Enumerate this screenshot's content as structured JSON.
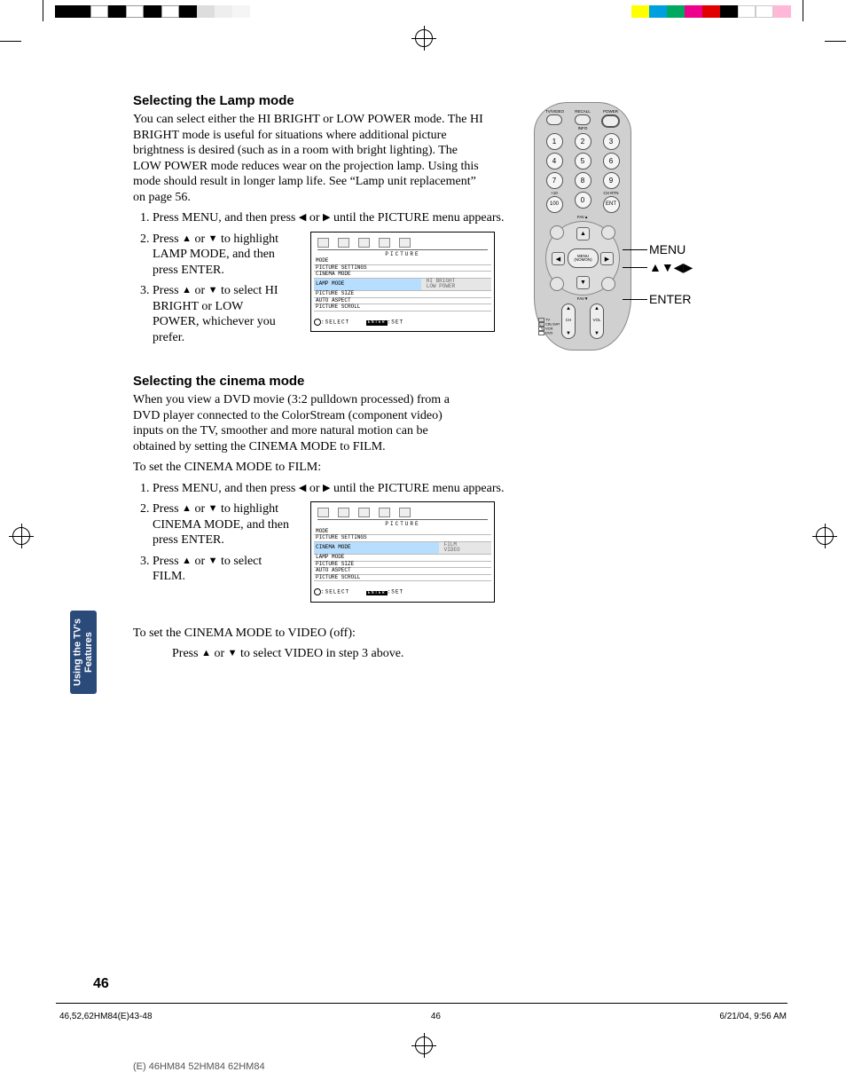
{
  "section1": {
    "heading": "Selecting the Lamp mode",
    "para": "You can select either the HI BRIGHT or LOW POWER mode. The HI BRIGHT mode is useful for situations where additional picture brightness is desired (such as in a room with bright lighting).  The LOW POWER mode reduces wear on the projection lamp. Using this mode should result in longer lamp life.  See “Lamp unit replacement” on page 56.",
    "step1a": "Press MENU, and then press ",
    "step1b": " or ",
    "step1c": " until the PICTURE menu appears.",
    "step2a": "Press ",
    "step2b": " or ",
    "step2c": " to highlight LAMP MODE, and then press ENTER.",
    "step3a": "Press ",
    "step3b": " or ",
    "step3c": " to select HI BRIGHT or LOW POWER, whichever you prefer."
  },
  "osd1": {
    "title": "PICTURE",
    "rows": [
      {
        "l": "MODE",
        "v": ""
      },
      {
        "l": "PICTURE SETTINGS",
        "v": ""
      },
      {
        "l": "CINEMA MODE",
        "v": ""
      },
      {
        "l": "LAMP MODE",
        "v_top": "HI BRIGHT",
        "v_bot": "LOW POWER",
        "hi": true
      },
      {
        "l": "PICTURE SIZE",
        "v": ""
      },
      {
        "l": "AUTO ASPECT",
        "v": ""
      },
      {
        "l": "PICTURE SCROLL",
        "v": ""
      }
    ],
    "footer_select": ":SELECT",
    "footer_enter": "ENTER",
    "footer_set": ":SET"
  },
  "section2": {
    "heading": "Selecting the cinema mode",
    "para": "When you view a DVD movie (3:2 pulldown processed) from a DVD player connected to the ColorStream (component video) inputs on the TV, smoother and more natural motion can be obtained by setting the CINEMA MODE to FILM.",
    "lead": "To set the CINEMA MODE to FILM:",
    "step1a": "Press MENU, and then press ",
    "step1b": " or ",
    "step1c": " until the PICTURE menu appears.",
    "step2a": "Press ",
    "step2b": " or ",
    "step2c": " to highlight CINEMA MODE, and then press ENTER.",
    "step3a": "Press ",
    "step3b": " or ",
    "step3c": " to select FILM.",
    "off_lead": "To set the CINEMA MODE to VIDEO (off):",
    "off_step_a": "Press ",
    "off_step_b": " or ",
    "off_step_c": " to select VIDEO in step 3 above."
  },
  "osd2": {
    "title": "PICTURE",
    "rows": [
      {
        "l": "MODE",
        "v": ""
      },
      {
        "l": "PICTURE SETTINGS",
        "v": ""
      },
      {
        "l": "CINEMA MODE",
        "v_top": "FILM",
        "v_bot": "VIDEO",
        "hi": true
      },
      {
        "l": "LAMP MODE",
        "v": ""
      },
      {
        "l": "PICTURE SIZE",
        "v": ""
      },
      {
        "l": "AUTO ASPECT",
        "v": ""
      },
      {
        "l": "PICTURE SCROLL",
        "v": ""
      }
    ],
    "footer_select": ":SELECT",
    "footer_enter": "ENTER",
    "footer_set": ":SET"
  },
  "remote": {
    "top_labels": [
      "TV/VIDEO",
      "RECALL",
      "POWER"
    ],
    "info": "INFO",
    "numbers": [
      "1",
      "2",
      "3",
      "4",
      "5",
      "6",
      "7",
      "8",
      "9",
      "0"
    ],
    "plus10": "+10",
    "ent": "ENT",
    "chrtn": "CH RTN",
    "hundred": "100",
    "fav_up": "FAV▲",
    "fav_dn": "FAV▼",
    "menu_btn": "MENU\n(NOMON)",
    "ch": "CH",
    "vol": "VOL",
    "modes": [
      "TV",
      "CBL/SAT",
      "VCR",
      "DVD"
    ]
  },
  "callouts": {
    "menu": "MENU",
    "arrows": "▲▼◀▶",
    "enter": "ENTER"
  },
  "sidetab": "Using the TV's\nFeatures",
  "pagenum": "46",
  "footer": {
    "left": "46,52,62HM84(E)43-48",
    "mid": "46",
    "right": "6/21/04, 9:56 AM"
  },
  "trimtitle": "(E) 46HM84  52HM84  62HM84",
  "leftcolors": [
    "#000",
    "#000",
    "#fff",
    "#000",
    "#fff",
    "#000",
    "#fff",
    "#000",
    "#fff",
    "#fff",
    "#fff"
  ],
  "rightcolors": [
    "#ffff00",
    "#00a0e0",
    "#00a860",
    "#ec008c",
    "#e00000",
    "#000",
    "#fff",
    "#fff",
    "#ffb8d8"
  ]
}
